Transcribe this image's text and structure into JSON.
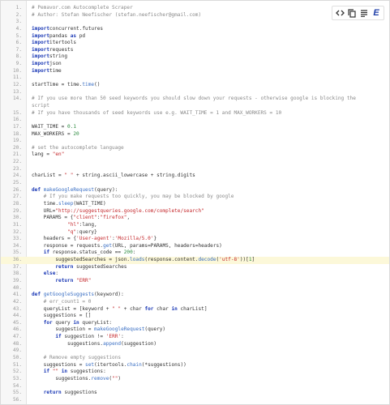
{
  "toolbar": {
    "buttons": [
      {
        "icon": "code-icon"
      },
      {
        "icon": "copy-icon"
      },
      {
        "icon": "lines-icon"
      },
      {
        "icon": "editor-e-icon",
        "label": "E"
      }
    ]
  },
  "code": {
    "lines": [
      {
        "n": "1.",
        "t": [
          [
            "cm",
            "# Pemavor.com Autocomplete Scraper"
          ]
        ]
      },
      {
        "n": "2.",
        "t": [
          [
            "cm",
            "# Author: Stefan Neefischer (stefan.neefischer@gmail.com)"
          ]
        ]
      },
      {
        "n": "3.",
        "t": []
      },
      {
        "n": "4.",
        "t": [
          [
            "kw",
            "import"
          ],
          [
            "",
            "concurrent.futures"
          ]
        ]
      },
      {
        "n": "5.",
        "t": [
          [
            "kw",
            "import"
          ],
          [
            "",
            "pandas "
          ],
          [
            "kw",
            "as"
          ],
          [
            "",
            " pd"
          ]
        ]
      },
      {
        "n": "6.",
        "t": [
          [
            "kw",
            "import"
          ],
          [
            "",
            "itertools"
          ]
        ]
      },
      {
        "n": "7.",
        "t": [
          [
            "kw",
            "import"
          ],
          [
            "",
            "requests"
          ]
        ]
      },
      {
        "n": "8.",
        "t": [
          [
            "kw",
            "import"
          ],
          [
            "",
            "string"
          ]
        ]
      },
      {
        "n": "9.",
        "t": [
          [
            "kw",
            "import"
          ],
          [
            "",
            "json"
          ]
        ]
      },
      {
        "n": "10.",
        "t": [
          [
            "kw",
            "import"
          ],
          [
            "",
            "time"
          ]
        ]
      },
      {
        "n": "11.",
        "t": []
      },
      {
        "n": "12.",
        "t": [
          [
            "",
            "startTime = time."
          ],
          [
            "fn",
            "time"
          ],
          [
            "",
            "()"
          ]
        ]
      },
      {
        "n": "13.",
        "t": []
      },
      {
        "n": "14.",
        "tall": true,
        "t": [
          [
            "cm",
            "# If you use more than 50 seed keywords you should slow down your requests - otherwise google is blocking the\nscript"
          ]
        ]
      },
      {
        "n": "15.",
        "t": [
          [
            "cm",
            "# If you have thousands of seed keywords use e.g. WAIT_TIME = 1 and MAX_WORKERS = 10"
          ]
        ]
      },
      {
        "n": "16.",
        "t": []
      },
      {
        "n": "17.",
        "t": [
          [
            "",
            "WAIT_TIME = "
          ],
          [
            "nm",
            "0.1"
          ]
        ]
      },
      {
        "n": "18.",
        "t": [
          [
            "",
            "MAX_WORKERS = "
          ],
          [
            "nm",
            "20"
          ]
        ]
      },
      {
        "n": "19.",
        "t": []
      },
      {
        "n": "20.",
        "t": [
          [
            "cm",
            "# set the autocomplete language"
          ]
        ]
      },
      {
        "n": "21.",
        "t": [
          [
            "",
            "lang = "
          ],
          [
            "st",
            "\"en\""
          ]
        ]
      },
      {
        "n": "22.",
        "t": []
      },
      {
        "n": "23.",
        "t": []
      },
      {
        "n": "24.",
        "t": [
          [
            "",
            "charList = "
          ],
          [
            "st",
            "\" \""
          ],
          [
            "",
            " + string.ascii_lowercase + string.digits"
          ]
        ]
      },
      {
        "n": "25.",
        "t": []
      },
      {
        "n": "26.",
        "t": [
          [
            "kw",
            "def"
          ],
          [
            "",
            " "
          ],
          [
            "fn",
            "makeGoogleRequest"
          ],
          [
            "",
            "(query):"
          ]
        ]
      },
      {
        "n": "27.",
        "t": [
          [
            "cm",
            "    # If you make requests too quickly, you may be blocked by google"
          ]
        ]
      },
      {
        "n": "28.",
        "t": [
          [
            "",
            "    time."
          ],
          [
            "fn",
            "sleep"
          ],
          [
            "",
            "(WAIT_TIME)"
          ]
        ]
      },
      {
        "n": "29.",
        "t": [
          [
            "",
            "    URL="
          ],
          [
            "st",
            "\"http://suggestqueries.google.com/complete/search\""
          ]
        ]
      },
      {
        "n": "30.",
        "t": [
          [
            "",
            "    PARAMS = {"
          ],
          [
            "st",
            "\"client\""
          ],
          [
            "",
            ":"
          ],
          [
            "st",
            "\"firefox\""
          ],
          [
            "",
            ","
          ]
        ]
      },
      {
        "n": "31.",
        "t": [
          [
            "",
            "            "
          ],
          [
            "st",
            "\"hl\""
          ],
          [
            "",
            ":lang,"
          ]
        ]
      },
      {
        "n": "32.",
        "t": [
          [
            "",
            "            "
          ],
          [
            "st",
            "\"q\""
          ],
          [
            "",
            ":query}"
          ]
        ]
      },
      {
        "n": "33.",
        "t": [
          [
            "",
            "    headers = {"
          ],
          [
            "st",
            "'User-agent'"
          ],
          [
            "",
            ":"
          ],
          [
            "st",
            "'Mozilla/5.0'"
          ],
          [
            "",
            "}"
          ]
        ]
      },
      {
        "n": "34.",
        "t": [
          [
            "",
            "    response = requests."
          ],
          [
            "fn",
            "get"
          ],
          [
            "",
            "(URL, params=PARAMS, headers=headers)"
          ]
        ]
      },
      {
        "n": "35.",
        "t": [
          [
            "",
            "    "
          ],
          [
            "kw",
            "if"
          ],
          [
            "",
            " response.status_code == "
          ],
          [
            "nm",
            "200"
          ],
          [
            "",
            ":"
          ]
        ]
      },
      {
        "n": "36.",
        "hl": true,
        "t": [
          [
            "",
            "        suggestedSearches = json."
          ],
          [
            "fn",
            "loads"
          ],
          [
            "",
            "(response.content."
          ],
          [
            "fn",
            "decode"
          ],
          [
            "",
            "("
          ],
          [
            "st",
            "'utf-8'"
          ],
          [
            "",
            "))["
          ],
          [
            "nm",
            "1"
          ],
          [
            "",
            "]"
          ]
        ]
      },
      {
        "n": "37.",
        "t": [
          [
            "",
            "        "
          ],
          [
            "kw",
            "return"
          ],
          [
            "",
            " suggestedSearches"
          ]
        ]
      },
      {
        "n": "38.",
        "t": [
          [
            "",
            "    "
          ],
          [
            "kw",
            "else"
          ],
          [
            "",
            ":"
          ]
        ]
      },
      {
        "n": "39.",
        "t": [
          [
            "",
            "        "
          ],
          [
            "kw",
            "return"
          ],
          [
            "",
            " "
          ],
          [
            "st",
            "\"ERR\""
          ]
        ]
      },
      {
        "n": "40.",
        "t": []
      },
      {
        "n": "41.",
        "t": [
          [
            "kw",
            "def"
          ],
          [
            "",
            " "
          ],
          [
            "fn",
            "getGoogleSuggests"
          ],
          [
            "",
            "(keyword):"
          ]
        ]
      },
      {
        "n": "42.",
        "t": [
          [
            "cm",
            "    # err_count1 = 0"
          ]
        ]
      },
      {
        "n": "43.",
        "t": [
          [
            "",
            "    queryList = [keyword + "
          ],
          [
            "st",
            "\" \""
          ],
          [
            "",
            " + char "
          ],
          [
            "kw",
            "for"
          ],
          [
            "",
            " char "
          ],
          [
            "kw",
            "in"
          ],
          [
            "",
            " charList]"
          ]
        ]
      },
      {
        "n": "44.",
        "t": [
          [
            "",
            "    suggestions = []"
          ]
        ]
      },
      {
        "n": "45.",
        "t": [
          [
            "",
            "    "
          ],
          [
            "kw",
            "for"
          ],
          [
            "",
            " query "
          ],
          [
            "kw",
            "in"
          ],
          [
            "",
            " queryList:"
          ]
        ]
      },
      {
        "n": "46.",
        "t": [
          [
            "",
            "        suggestion = "
          ],
          [
            "fn",
            "makeGoogleRequest"
          ],
          [
            "",
            "(query)"
          ]
        ]
      },
      {
        "n": "47.",
        "t": [
          [
            "",
            "        "
          ],
          [
            "kw",
            "if"
          ],
          [
            "",
            " suggestion != "
          ],
          [
            "st",
            "'ERR'"
          ],
          [
            "",
            ":"
          ]
        ]
      },
      {
        "n": "48.",
        "t": [
          [
            "",
            "            suggestions."
          ],
          [
            "fn",
            "append"
          ],
          [
            "",
            "(suggestion)"
          ]
        ]
      },
      {
        "n": "49.",
        "t": []
      },
      {
        "n": "50.",
        "t": [
          [
            "cm",
            "    # Remove empty suggestions"
          ]
        ]
      },
      {
        "n": "51.",
        "t": [
          [
            "",
            "    suggestions = "
          ],
          [
            "fn",
            "set"
          ],
          [
            "",
            "(itertools."
          ],
          [
            "fn",
            "chain"
          ],
          [
            "",
            "(*suggestions))"
          ]
        ]
      },
      {
        "n": "52.",
        "t": [
          [
            "",
            "    "
          ],
          [
            "kw",
            "if"
          ],
          [
            "",
            " "
          ],
          [
            "st",
            "\"\""
          ],
          [
            "",
            " "
          ],
          [
            "kw",
            "in"
          ],
          [
            "",
            " suggestions:"
          ]
        ]
      },
      {
        "n": "53.",
        "t": [
          [
            "",
            "        suggestions."
          ],
          [
            "fn",
            "remove"
          ],
          [
            "",
            "("
          ],
          [
            "st",
            "\"\""
          ],
          [
            "",
            ")"
          ]
        ]
      },
      {
        "n": "54.",
        "t": []
      },
      {
        "n": "55.",
        "t": [
          [
            "",
            "    "
          ],
          [
            "kw",
            "return"
          ],
          [
            "",
            " suggestions"
          ]
        ]
      },
      {
        "n": "56.",
        "t": []
      }
    ]
  }
}
